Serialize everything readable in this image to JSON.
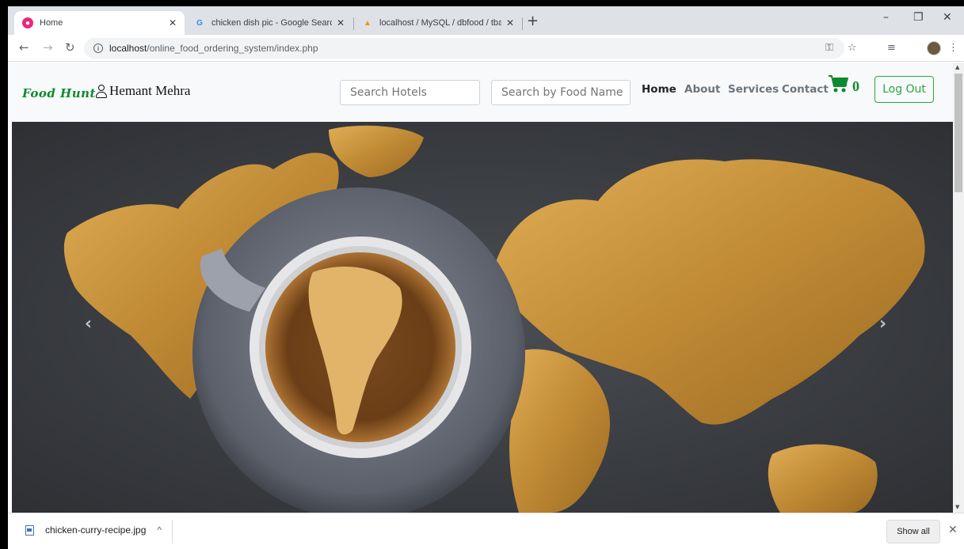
{
  "browser": {
    "tabs": [
      {
        "title": "Home",
        "icon": "site-favicon"
      },
      {
        "title": "chicken dish pic - Google Search",
        "icon": "google-favicon"
      },
      {
        "title": "localhost / MySQL / dbfood / tba",
        "icon": "phpmyadmin-favicon"
      }
    ],
    "new_tab": "+",
    "url_host": "localhost",
    "url_path": "/online_food_ordering_system/index.php",
    "window_controls": {
      "minimize": "–",
      "restore": "❐",
      "close": "✕"
    }
  },
  "site": {
    "brand": "Food Hunt",
    "user_name": "Hemant Mehra",
    "search_hotels_placeholder": "Search Hotels",
    "search_food_placeholder": "Search by Food Name",
    "menu": [
      "Home",
      "About",
      "Services",
      "Contact"
    ],
    "cart_count": "0",
    "logout_label": "Log Out",
    "accent_color": "#28a745"
  },
  "carousel": {
    "prev": "‹",
    "next": "›"
  },
  "downloads": {
    "file_name": "chicken-curry-recipe.jpg",
    "expand": "^",
    "show_all": "Show all",
    "close": "✕"
  }
}
